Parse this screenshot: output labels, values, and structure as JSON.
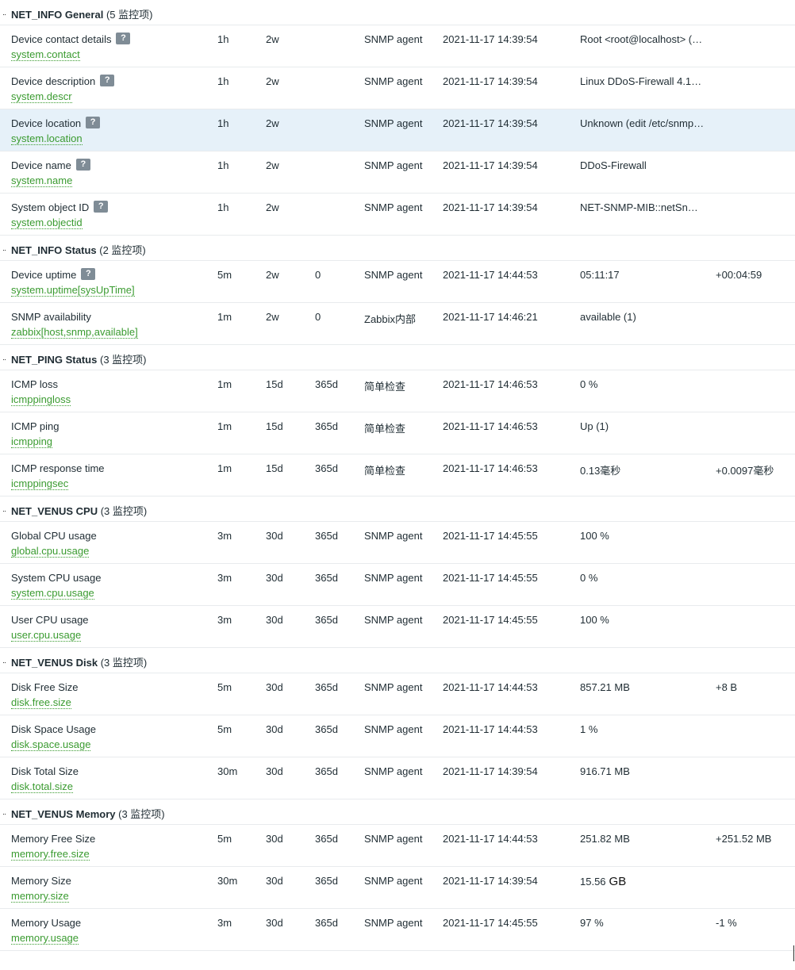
{
  "groups": [
    {
      "title": "NET_INFO General",
      "count": "(5 监控项)",
      "items": [
        {
          "name": "Device contact details",
          "help": true,
          "key": "system.contact",
          "interval": "1h",
          "history": "2w",
          "trends": "",
          "type": "SNMP agent",
          "last_check": "2021-11-17 14:39:54",
          "value": "Root <root@localhost> (…",
          "change": ""
        },
        {
          "name": "Device description",
          "help": true,
          "key": "system.descr",
          "interval": "1h",
          "history": "2w",
          "trends": "",
          "type": "SNMP agent",
          "last_check": "2021-11-17 14:39:54",
          "value": "Linux DDoS-Firewall 4.1…",
          "change": ""
        },
        {
          "name": "Device location",
          "help": true,
          "key": "system.location",
          "interval": "1h",
          "history": "2w",
          "trends": "",
          "type": "SNMP agent",
          "last_check": "2021-11-17 14:39:54",
          "value": "Unknown (edit /etc/snmp…",
          "change": "",
          "highlight": true
        },
        {
          "name": "Device name",
          "help": true,
          "key": "system.name",
          "interval": "1h",
          "history": "2w",
          "trends": "",
          "type": "SNMP agent",
          "last_check": "2021-11-17 14:39:54",
          "value": "DDoS-Firewall",
          "change": ""
        },
        {
          "name": "System object ID",
          "help": true,
          "key": "system.objectid",
          "interval": "1h",
          "history": "2w",
          "trends": "",
          "type": "SNMP agent",
          "last_check": "2021-11-17 14:39:54",
          "value": "NET-SNMP-MIB::netSn…",
          "change": ""
        }
      ]
    },
    {
      "title": "NET_INFO Status",
      "count": "(2 监控项)",
      "items": [
        {
          "name": "Device uptime",
          "help": true,
          "key": "system.uptime[sysUpTime]",
          "interval": "5m",
          "history": "2w",
          "trends": "0",
          "type": "SNMP agent",
          "last_check": "2021-11-17 14:44:53",
          "value": "05:11:17",
          "change": "+00:04:59"
        },
        {
          "name": "SNMP availability",
          "help": false,
          "key": "zabbix[host,snmp,available]",
          "interval": "1m",
          "history": "2w",
          "trends": "0",
          "type": "Zabbix内部",
          "last_check": "2021-11-17 14:46:21",
          "value": "available (1)",
          "change": ""
        }
      ]
    },
    {
      "title": "NET_PING Status",
      "count": "(3 监控项)",
      "items": [
        {
          "name": "ICMP loss",
          "help": false,
          "key": "icmppingloss",
          "interval": "1m",
          "history": "15d",
          "trends": "365d",
          "type": "简单检查",
          "last_check": "2021-11-17 14:46:53",
          "value": "0 %",
          "change": ""
        },
        {
          "name": "ICMP ping",
          "help": false,
          "key": "icmpping",
          "interval": "1m",
          "history": "15d",
          "trends": "365d",
          "type": "简单检查",
          "last_check": "2021-11-17 14:46:53",
          "value": "Up (1)",
          "change": ""
        },
        {
          "name": "ICMP response time",
          "help": false,
          "key": "icmppingsec",
          "interval": "1m",
          "history": "15d",
          "trends": "365d",
          "type": "简单检查",
          "last_check": "2021-11-17 14:46:53",
          "value": "0.13毫秒",
          "change": "+0.0097毫秒"
        }
      ]
    },
    {
      "title": "NET_VENUS CPU",
      "count": "(3 监控项)",
      "items": [
        {
          "name": "Global CPU usage",
          "help": false,
          "key": "global.cpu.usage",
          "interval": "3m",
          "history": "30d",
          "trends": "365d",
          "type": "SNMP agent",
          "last_check": "2021-11-17 14:45:55",
          "value": "100 %",
          "change": ""
        },
        {
          "name": "System CPU usage",
          "help": false,
          "key": "system.cpu.usage",
          "interval": "3m",
          "history": "30d",
          "trends": "365d",
          "type": "SNMP agent",
          "last_check": "2021-11-17 14:45:55",
          "value": "0 %",
          "change": ""
        },
        {
          "name": "User CPU usage",
          "help": false,
          "key": "user.cpu.usage",
          "interval": "3m",
          "history": "30d",
          "trends": "365d",
          "type": "SNMP agent",
          "last_check": "2021-11-17 14:45:55",
          "value": "100 %",
          "change": ""
        }
      ]
    },
    {
      "title": "NET_VENUS Disk",
      "count": "(3 监控项)",
      "items": [
        {
          "name": "Disk Free Size",
          "help": false,
          "key": "disk.free.size",
          "interval": "5m",
          "history": "30d",
          "trends": "365d",
          "type": "SNMP agent",
          "last_check": "2021-11-17 14:44:53",
          "value": "857.21 MB",
          "change": "+8 B"
        },
        {
          "name": "Disk Space Usage",
          "help": false,
          "key": "disk.space.usage",
          "interval": "5m",
          "history": "30d",
          "trends": "365d",
          "type": "SNMP agent",
          "last_check": "2021-11-17 14:44:53",
          "value": "1 %",
          "change": ""
        },
        {
          "name": "Disk Total Size",
          "help": false,
          "key": "disk.total.size",
          "interval": "30m",
          "history": "30d",
          "trends": "365d",
          "type": "SNMP agent",
          "last_check": "2021-11-17 14:39:54",
          "value": "916.71 MB",
          "change": ""
        }
      ]
    },
    {
      "title": "NET_VENUS Memory",
      "count": "(3 监控项)",
      "items": [
        {
          "name": "Memory Free Size",
          "help": false,
          "key": "memory.free.size",
          "interval": "5m",
          "history": "30d",
          "trends": "365d",
          "type": "SNMP agent",
          "last_check": "2021-11-17 14:44:53",
          "value": "251.82 MB",
          "change": "+251.52 MB"
        },
        {
          "name": "Memory Size",
          "help": false,
          "key": "memory.size",
          "interval": "30m",
          "history": "30d",
          "trends": "365d",
          "type": "SNMP agent",
          "last_check": "2021-11-17 14:39:54",
          "value": "15.56",
          "value_suffix": "GB",
          "change": ""
        },
        {
          "name": "Memory Usage",
          "help": false,
          "key": "memory.usage",
          "interval": "3m",
          "history": "30d",
          "trends": "365d",
          "type": "SNMP agent",
          "last_check": "2021-11-17 14:45:55",
          "value": "97 %",
          "change": "-1 %"
        }
      ]
    }
  ]
}
